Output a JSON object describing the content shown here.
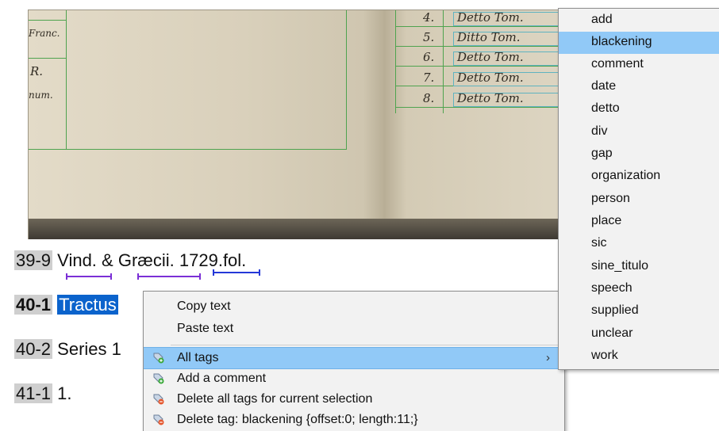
{
  "document": {
    "lines": [
      {
        "id": "39-9",
        "text_parts": [
          "Vind.",
          "&",
          "Græcii.",
          "1729.",
          "fol."
        ]
      },
      {
        "id": "40-1",
        "selected_text": "Tractus",
        "bold_id": true
      },
      {
        "id": "40-2",
        "text": "Series 1"
      },
      {
        "id": "41-1",
        "text": "1."
      }
    ],
    "scan_handwriting": [
      "4.",
      "Detto  Tom.",
      "5.",
      "Ditto  Tom.",
      "6.",
      "Detto  Tom.",
      "7.",
      "Detto  Tom.",
      "8.",
      "Detto  Tom."
    ],
    "scan_left_fragments": [
      "Franc.",
      "R.",
      "num."
    ]
  },
  "context_menu": {
    "items": [
      {
        "label": "Copy text",
        "icon": null
      },
      {
        "label": "Paste text",
        "icon": null
      },
      {
        "label": "All tags",
        "icon": "tag-add-icon",
        "has_submenu": true,
        "highlighted": true
      },
      {
        "label": "Add a comment",
        "icon": "tag-add-icon"
      },
      {
        "label": "Delete all tags for current selection",
        "icon": "tag-delete-icon"
      },
      {
        "label": "Delete tag: blackening {offset:0; length:11;}",
        "icon": "tag-delete-icon"
      }
    ],
    "submenu_arrow": "›"
  },
  "tags_submenu": {
    "items": [
      "add",
      "blackening",
      "comment",
      "date",
      "detto",
      "div",
      "gap",
      "organization",
      "person",
      "place",
      "sic",
      "sine_titulo",
      "speech",
      "supplied",
      "unclear",
      "work"
    ],
    "highlighted": "blackening"
  },
  "colors": {
    "selection": "#0b63cc",
    "menu_highlight": "#91c9f7",
    "underline_purple": "#7b2fd6",
    "underline_blue": "#2438d8",
    "line_number_bg": "#cfcfcf"
  }
}
